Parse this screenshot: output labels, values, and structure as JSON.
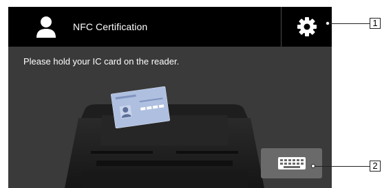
{
  "header": {
    "title": "NFC Certification",
    "user_icon": "user-icon",
    "settings_icon": "gear-icon"
  },
  "main": {
    "message": "Please hold your IC card on the reader.",
    "illustration": "nfc-reader-with-ic-card",
    "keyboard_icon": "keyboard-icon"
  },
  "callouts": {
    "one": "1",
    "two": "2"
  },
  "colors": {
    "header_bg": "#000000",
    "screen_bg": "#3a3a3a",
    "card": "#aebfe0",
    "keyboard_button": "#6a6a6a"
  }
}
